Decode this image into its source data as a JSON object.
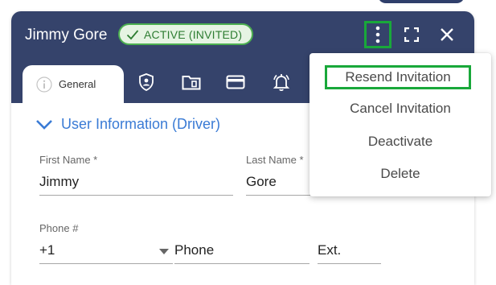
{
  "header": {
    "title": "Jimmy Gore",
    "status_badge": "ACTIVE (INVITED)"
  },
  "tabs": {
    "active_label": "General",
    "icons": [
      "info-icon",
      "shield-user-icon",
      "folder-icon",
      "credit-card-icon",
      "bell-icon"
    ]
  },
  "section": {
    "title": "User Information (Driver)"
  },
  "form": {
    "first_name_label": "First Name *",
    "first_name_value": "Jimmy",
    "last_name_label": "Last Name *",
    "last_name_value": "Gore",
    "phone_label": "Phone #",
    "country_code": "+1",
    "phone_placeholder": "Phone",
    "ext_placeholder": "Ext."
  },
  "menu": {
    "items": [
      "Resend Invitation",
      "Cancel Invitation",
      "Deactivate",
      "Delete"
    ]
  },
  "colors": {
    "header_bg": "#35436b",
    "accent_blue": "#3a7bd5",
    "badge_green": "#4caf50",
    "highlight_green": "#19a83a"
  }
}
